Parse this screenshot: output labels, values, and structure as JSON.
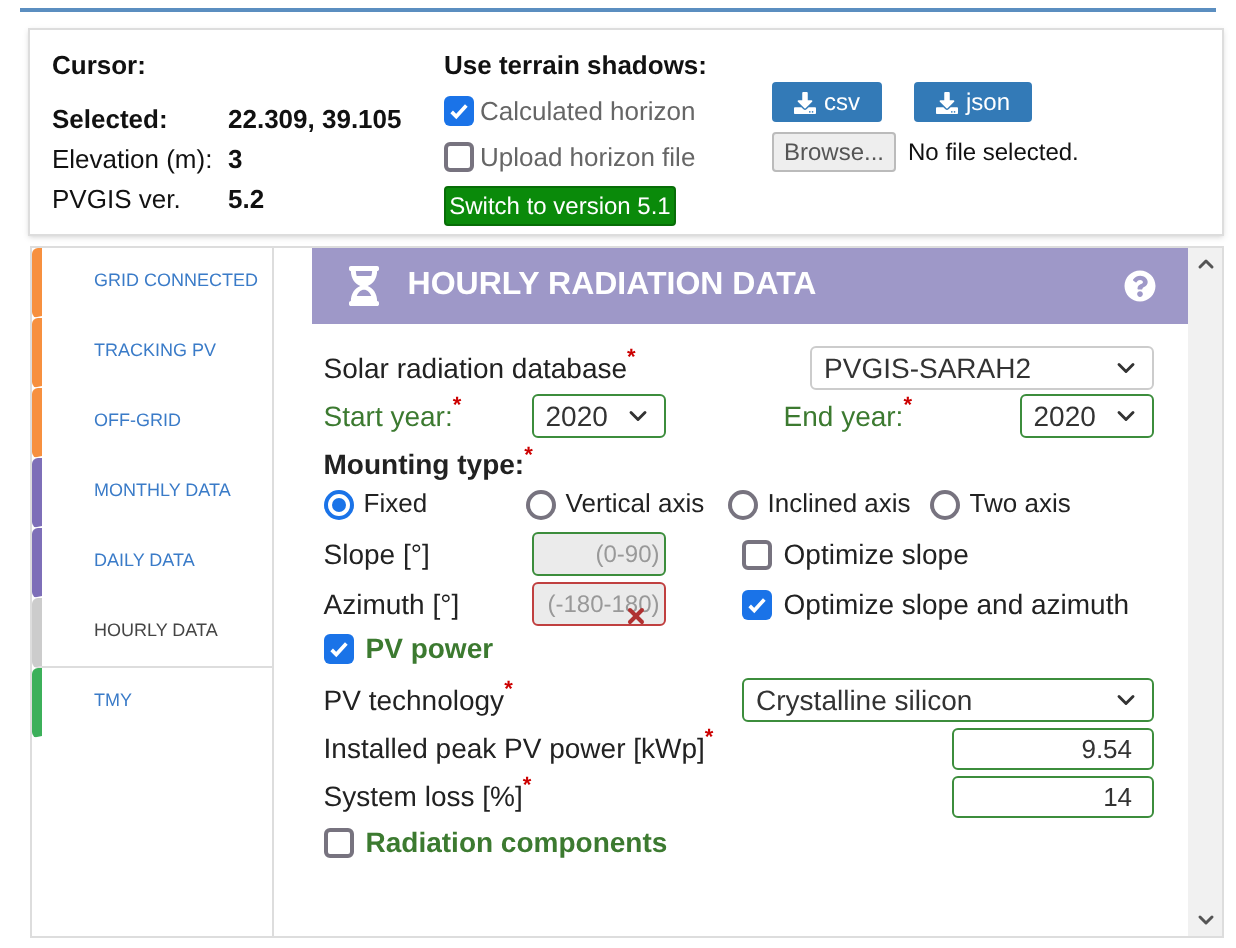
{
  "cursor": {
    "title": "Cursor:",
    "rows": [
      {
        "label": "Selected:",
        "value": "22.309, 39.105",
        "emphasized": true
      },
      {
        "label": "Elevation (m):",
        "value": "3",
        "emphasized": false
      },
      {
        "label": "PVGIS ver.",
        "value": "5.2",
        "emphasized": false
      }
    ]
  },
  "terrain": {
    "title": "Use terrain shadows:",
    "options": [
      {
        "label": "Calculated horizon",
        "checked": true
      },
      {
        "label": "Upload horizon file",
        "checked": false
      }
    ],
    "switch_button": "Switch to version 5.1"
  },
  "downloads": {
    "buttons": [
      "csv",
      "json"
    ],
    "browse_button": "Browse...",
    "file_status": "No file selected."
  },
  "sidebar": {
    "items": [
      {
        "label": "GRID CONNECTED",
        "color": "#f7903f",
        "selected": false
      },
      {
        "label": "TRACKING PV",
        "color": "#f7903f",
        "selected": false
      },
      {
        "label": "OFF-GRID",
        "color": "#f7903f",
        "selected": false
      },
      {
        "label": "MONTHLY DATA",
        "color": "#7e6fb8",
        "selected": false
      },
      {
        "label": "DAILY DATA",
        "color": "#7e6fb8",
        "selected": false
      },
      {
        "label": "HOURLY DATA",
        "color": "#cccccc",
        "selected": true
      },
      {
        "label": "TMY",
        "color": "#3cb05a",
        "selected": false
      }
    ]
  },
  "panel": {
    "title": "HOURLY RADIATION DATA",
    "required_mark": "*",
    "database": {
      "label": "Solar radiation database",
      "value": "PVGIS-SARAH2"
    },
    "start_year": {
      "label": "Start year:",
      "value": "2020"
    },
    "end_year": {
      "label": "End year:",
      "value": "2020"
    },
    "mounting": {
      "label": "Mounting type:",
      "options": [
        {
          "label": "Fixed",
          "selected": true
        },
        {
          "label": "Vertical axis",
          "selected": false
        },
        {
          "label": "Inclined axis",
          "selected": false
        },
        {
          "label": "Two axis",
          "selected": false
        }
      ]
    },
    "slope": {
      "label": "Slope [°]",
      "placeholder": "(0-90)",
      "error": false,
      "optimize": {
        "label": "Optimize slope",
        "checked": false
      }
    },
    "azimuth": {
      "label": "Azimuth [°]",
      "placeholder": "(-180-180)",
      "error": true,
      "optimize": {
        "label": "Optimize slope and azimuth",
        "checked": true
      }
    },
    "pv_power": {
      "label": "PV power",
      "checked": true
    },
    "pv_technology": {
      "label": "PV technology",
      "value": "Crystalline silicon"
    },
    "peak_power": {
      "label": "Installed peak PV power [kWp]",
      "value": "9.54"
    },
    "system_loss": {
      "label": "System loss [%]",
      "value": "14"
    },
    "radiation_components": {
      "label": "Radiation components",
      "checked": false
    }
  }
}
